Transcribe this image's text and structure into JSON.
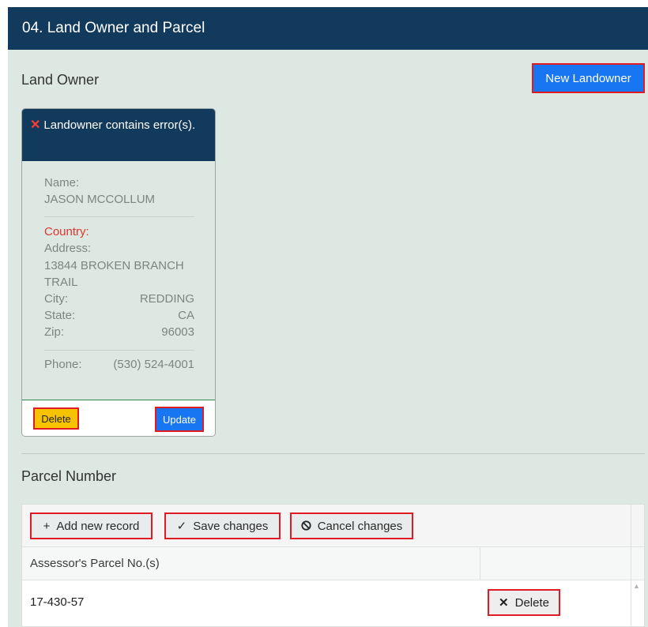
{
  "panel": {
    "title": "04. Land Owner and Parcel"
  },
  "land_owner": {
    "section_title": "Land Owner",
    "new_button": "New Landowner",
    "card": {
      "error_icon": "close-icon",
      "error_text": "Landowner contains error(s).",
      "name_label": "Name:",
      "name_value": "JASON MCCOLLUM",
      "country_label": "Country:",
      "address_label": "Address:",
      "address_line1": "13844 BROKEN BRANCH",
      "address_line2": "TRAIL",
      "city_label": "City:",
      "city_value": "REDDING",
      "state_label": "State:",
      "state_value": "CA",
      "zip_label": "Zip:",
      "zip_value": "96003",
      "phone_label": "Phone:",
      "phone_value": "(530) 524-4001",
      "delete_button": "Delete",
      "update_button": "Update"
    }
  },
  "parcel": {
    "section_title": "Parcel Number",
    "toolbar": {
      "add_icon": "plus-icon",
      "add_label": "Add new record",
      "save_icon": "checkmark-icon",
      "save_label": "Save changes",
      "cancel_icon": "cancel-circle-icon",
      "cancel_label": "Cancel changes"
    },
    "columns": [
      "Assessor's Parcel No.(s)",
      ""
    ],
    "rows": [
      {
        "parcel_no": "17-430-57",
        "delete_label": "Delete",
        "delete_icon": "close-icon"
      }
    ]
  },
  "colors": {
    "header_bg": "#123a5c",
    "panel_bg": "#dde8e3",
    "primary_button": "#1976f2",
    "warning_button": "#f7c300",
    "highlight_outline": "#e01b24",
    "error_text": "#e0362c"
  }
}
